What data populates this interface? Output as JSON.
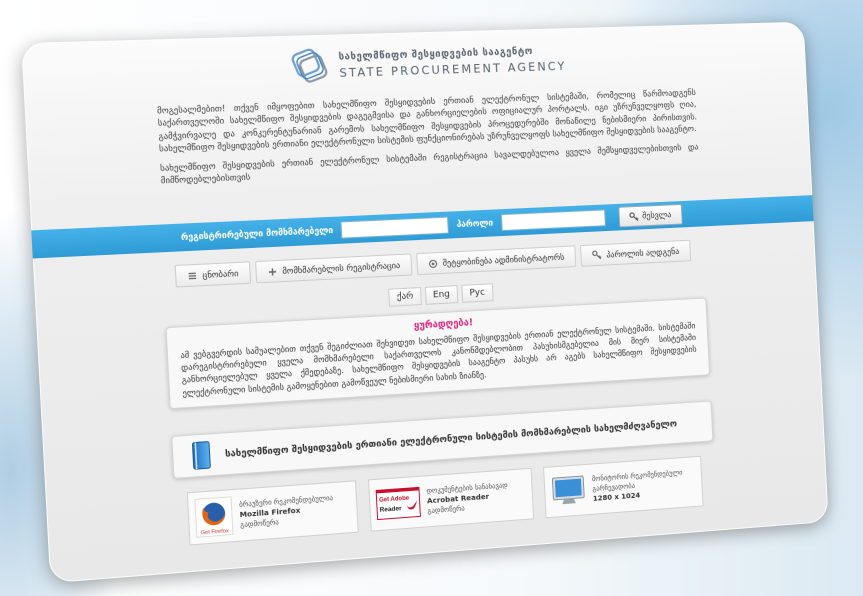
{
  "header": {
    "logo_ka": "სახელმწიფო შესყიდვების სააგენტო",
    "logo_en": "STATE PROCUREMENT AGENCY",
    "logo_icon": "agency-logo-icon"
  },
  "intro": {
    "p1": "მოგესალმებით! თქვენ იმყოფებით სახელმწიფო შესყიდვების ერთიან ელექტრონულ სისტემაში, რომელიც წარმოადგენს საქართველოში სახელმწიფო შესყიდვების დაგეგმვისა და განხორციელების ოფიციალურ პორტალს. იგი უზრუნველყოფს ღია, გამჭვირვალე და კონკურენტუნარიან გარემოს სახელმწიფო შესყიდვების პროცედურებში მონაწილე ნებისმიერი პირისთვის. სახელმწიფო შესყიდვების ერთიანი ელექტრონული სისტემის ფუნქციონირებას უზრუნველყოფს სახელმწიფო შესყიდვების სააგენტო.",
    "p2": "სახელმწიფო შესყიდვების ერთიან ელექტრონულ სისტემაში რეგისტრაცია სავალდებულოა ყველა შემსყიდველებისთვის და მიმწოდებლებისთვის"
  },
  "login": {
    "username_label": "რეგისტრირებული მომხმარებელი",
    "password_label": "პაროლი",
    "submit_label": "შესვლა",
    "submit_icon": "key-icon"
  },
  "nav": {
    "items": [
      {
        "label": "ცნობარი",
        "icon": "list-icon"
      },
      {
        "label": "მომხმარებლის რეგისტრაცია",
        "icon": "plus-icon"
      },
      {
        "label": "შეტყობინება ადმინისტრატორს",
        "icon": "message-icon"
      },
      {
        "label": "პაროლის აღდგენა",
        "icon": "key-icon"
      }
    ]
  },
  "languages": {
    "items": [
      {
        "label": "ქარ"
      },
      {
        "label": "Eng"
      },
      {
        "label": "Рус"
      }
    ]
  },
  "notice": {
    "title": "ყურადღება!",
    "text": "ამ ვებგვერდის საშუალებით თქვენ შეგიძლიათ შეხვიდეთ სახელმწიფო შესყიდვების ერთიან ელექტრონულ სისტემაში. სისტემაში დარეგისტრირებული ყველა მომხმარებელი საქართველოს კანონმდებლობით პასუხისმგებელია მის მიერ სისტემაში განხორციელებულ ყველა ქმედებაზე. სახელმწიფო შესყიდვების სააგენტო პასუხს არ აგებს სახელმწიფო შესყიდვების ელექტრონული სისტემის გამოყენებით გამოწვეულ ნებისმიერი სახის ზიანზე."
  },
  "manual": {
    "label": "სახელმწიფო შესყიდვების ერთიანი ელექტრონული სისტემის მომხმარებლის სახელმძღვანელო",
    "icon": "book-icon"
  },
  "downloads": {
    "items": [
      {
        "icon": "firefox-logo",
        "logo_text": "Get Firefox",
        "caption": "ბრაუზერი რეკომენდებულია",
        "name": "Mozilla Firefox",
        "action": "გადმოწერა"
      },
      {
        "icon": "adobe-reader-logo",
        "logo_text_1": "Get Adobe",
        "logo_text_2": "Reader",
        "caption": "დოკუმენტების სანახავად",
        "name": "Acrobat Reader",
        "action": "გადმოწერა"
      },
      {
        "icon": "monitor-icon",
        "caption": "მონიტორის რეკომენდებული",
        "caption_2": "გარჩევადობა",
        "value": "1280 x 1024"
      }
    ]
  },
  "colors": {
    "accent": "#3aa6de",
    "notice_title": "#e2237d",
    "card": "#ececec"
  }
}
